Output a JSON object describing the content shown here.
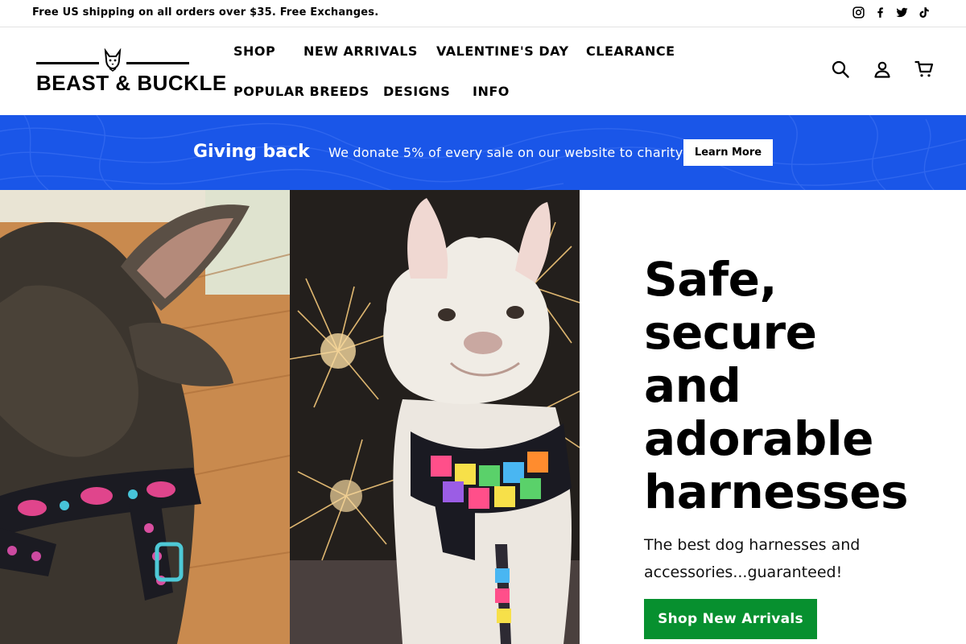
{
  "announcement": {
    "text": "Free US shipping on all orders over $35. Free Exchanges."
  },
  "social": [
    "instagram-icon",
    "facebook-icon",
    "twitter-icon",
    "tiktok-icon"
  ],
  "logo": {
    "text": "BEAST & BUCKLE"
  },
  "nav": {
    "items": [
      {
        "label": "SHOP"
      },
      {
        "label": "NEW ARRIVALS"
      },
      {
        "label": "VALENTINE'S DAY"
      },
      {
        "label": "CLEARANCE"
      },
      {
        "label": "POPULAR BREEDS"
      },
      {
        "label": "DESIGNS"
      },
      {
        "label": "INFO"
      }
    ]
  },
  "header_icons": [
    "search-icon",
    "account-icon",
    "cart-icon"
  ],
  "giving": {
    "title": "Giving back",
    "text": "We donate 5% of every sale on our website to charity",
    "button": "Learn More",
    "bg_color": "#1a56e8"
  },
  "hero": {
    "headline_lines": [
      "Safe,",
      "secure",
      "and",
      "adorable",
      "harnesses"
    ],
    "subtext_lines": [
      "The best dog harnesses and",
      "accessories...guaranteed!"
    ],
    "cta": "Shop New Arrivals",
    "cta_color": "#07902f"
  }
}
